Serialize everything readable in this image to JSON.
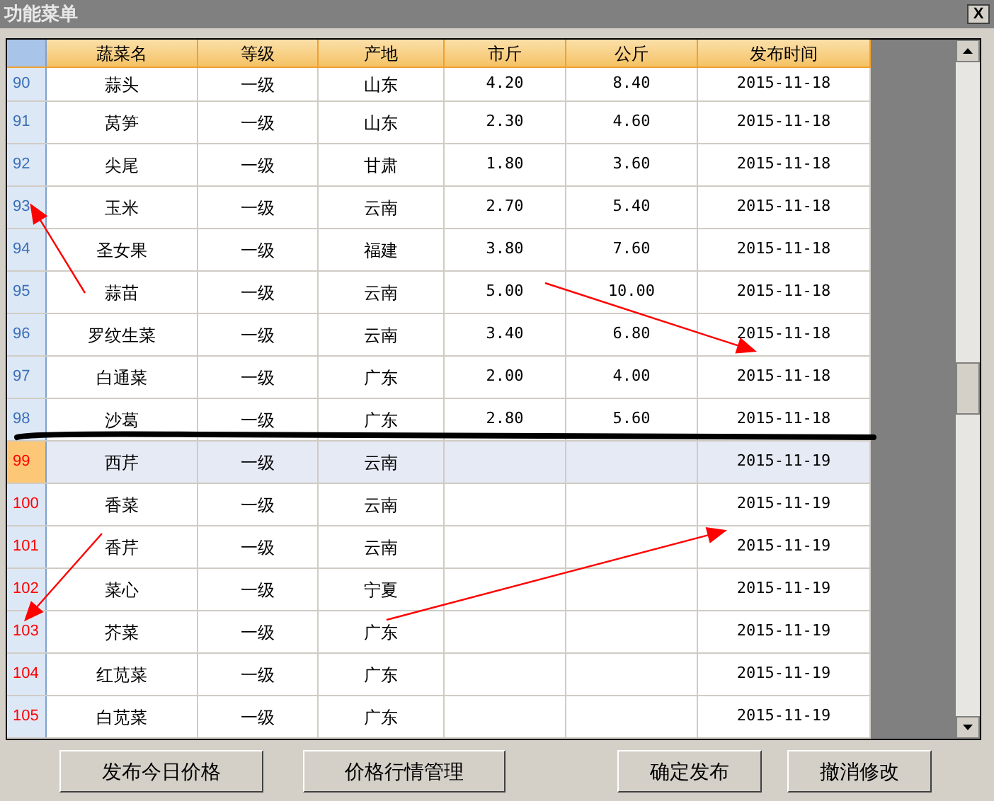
{
  "window": {
    "title": "功能菜单",
    "close_label": "X"
  },
  "table": {
    "columns": [
      "蔬菜名",
      "等级",
      "产地",
      "市斤",
      "公斤",
      "发布时间"
    ],
    "rows": [
      {
        "number": "90",
        "color": "#3b6fb6",
        "selected": false,
        "cells": [
          "蒜头",
          "一级",
          "山东",
          "4.20",
          "8.40",
          "2015-11-18"
        ]
      },
      {
        "number": "91",
        "color": "#3b6fb6",
        "selected": false,
        "cells": [
          "莴笋",
          "一级",
          "山东",
          "2.30",
          "4.60",
          "2015-11-18"
        ]
      },
      {
        "number": "92",
        "color": "#3b6fb6",
        "selected": false,
        "cells": [
          "尖尾",
          "一级",
          "甘肃",
          "1.80",
          "3.60",
          "2015-11-18"
        ]
      },
      {
        "number": "93",
        "color": "#3b6fb6",
        "selected": false,
        "cells": [
          "玉米",
          "一级",
          "云南",
          "2.70",
          "5.40",
          "2015-11-18"
        ]
      },
      {
        "number": "94",
        "color": "#3b6fb6",
        "selected": false,
        "cells": [
          "圣女果",
          "一级",
          "福建",
          "3.80",
          "7.60",
          "2015-11-18"
        ]
      },
      {
        "number": "95",
        "color": "#3b6fb6",
        "selected": false,
        "cells": [
          "蒜苗",
          "一级",
          "云南",
          "5.00",
          "10.00",
          "2015-11-18"
        ]
      },
      {
        "number": "96",
        "color": "#3b6fb6",
        "selected": false,
        "cells": [
          "罗纹生菜",
          "一级",
          "云南",
          "3.40",
          "6.80",
          "2015-11-18"
        ]
      },
      {
        "number": "97",
        "color": "#3b6fb6",
        "selected": false,
        "cells": [
          "白通菜",
          "一级",
          "广东",
          "2.00",
          "4.00",
          "2015-11-18"
        ]
      },
      {
        "number": "98",
        "color": "#3b6fb6",
        "selected": false,
        "cells": [
          "沙葛",
          "一级",
          "广东",
          "2.80",
          "5.60",
          "2015-11-18"
        ]
      },
      {
        "number": "99",
        "color": "#ff0000",
        "selected": true,
        "cells": [
          "西芹",
          "一级",
          "云南",
          "",
          "",
          "2015-11-19"
        ]
      },
      {
        "number": "100",
        "color": "#ff0000",
        "selected": false,
        "cells": [
          "香菜",
          "一级",
          "云南",
          "",
          "",
          "2015-11-19"
        ]
      },
      {
        "number": "101",
        "color": "#ff0000",
        "selected": false,
        "cells": [
          "香芹",
          "一级",
          "云南",
          "",
          "",
          "2015-11-19"
        ]
      },
      {
        "number": "102",
        "color": "#ff0000",
        "selected": false,
        "cells": [
          "菜心",
          "一级",
          "宁夏",
          "",
          "",
          "2015-11-19"
        ]
      },
      {
        "number": "103",
        "color": "#ff0000",
        "selected": false,
        "cells": [
          "芥菜",
          "一级",
          "广东",
          "",
          "",
          "2015-11-19"
        ]
      },
      {
        "number": "104",
        "color": "#ff0000",
        "selected": false,
        "cells": [
          "红苋菜",
          "一级",
          "广东",
          "",
          "",
          "2015-11-19"
        ]
      },
      {
        "number": "105",
        "color": "#ff0000",
        "selected": false,
        "cells": [
          "白苋菜",
          "一级",
          "广东",
          "",
          "",
          "2015-11-19"
        ]
      }
    ]
  },
  "buttons": [
    "发布今日价格",
    "价格行情管理",
    "确定发布",
    "撤消修改"
  ]
}
